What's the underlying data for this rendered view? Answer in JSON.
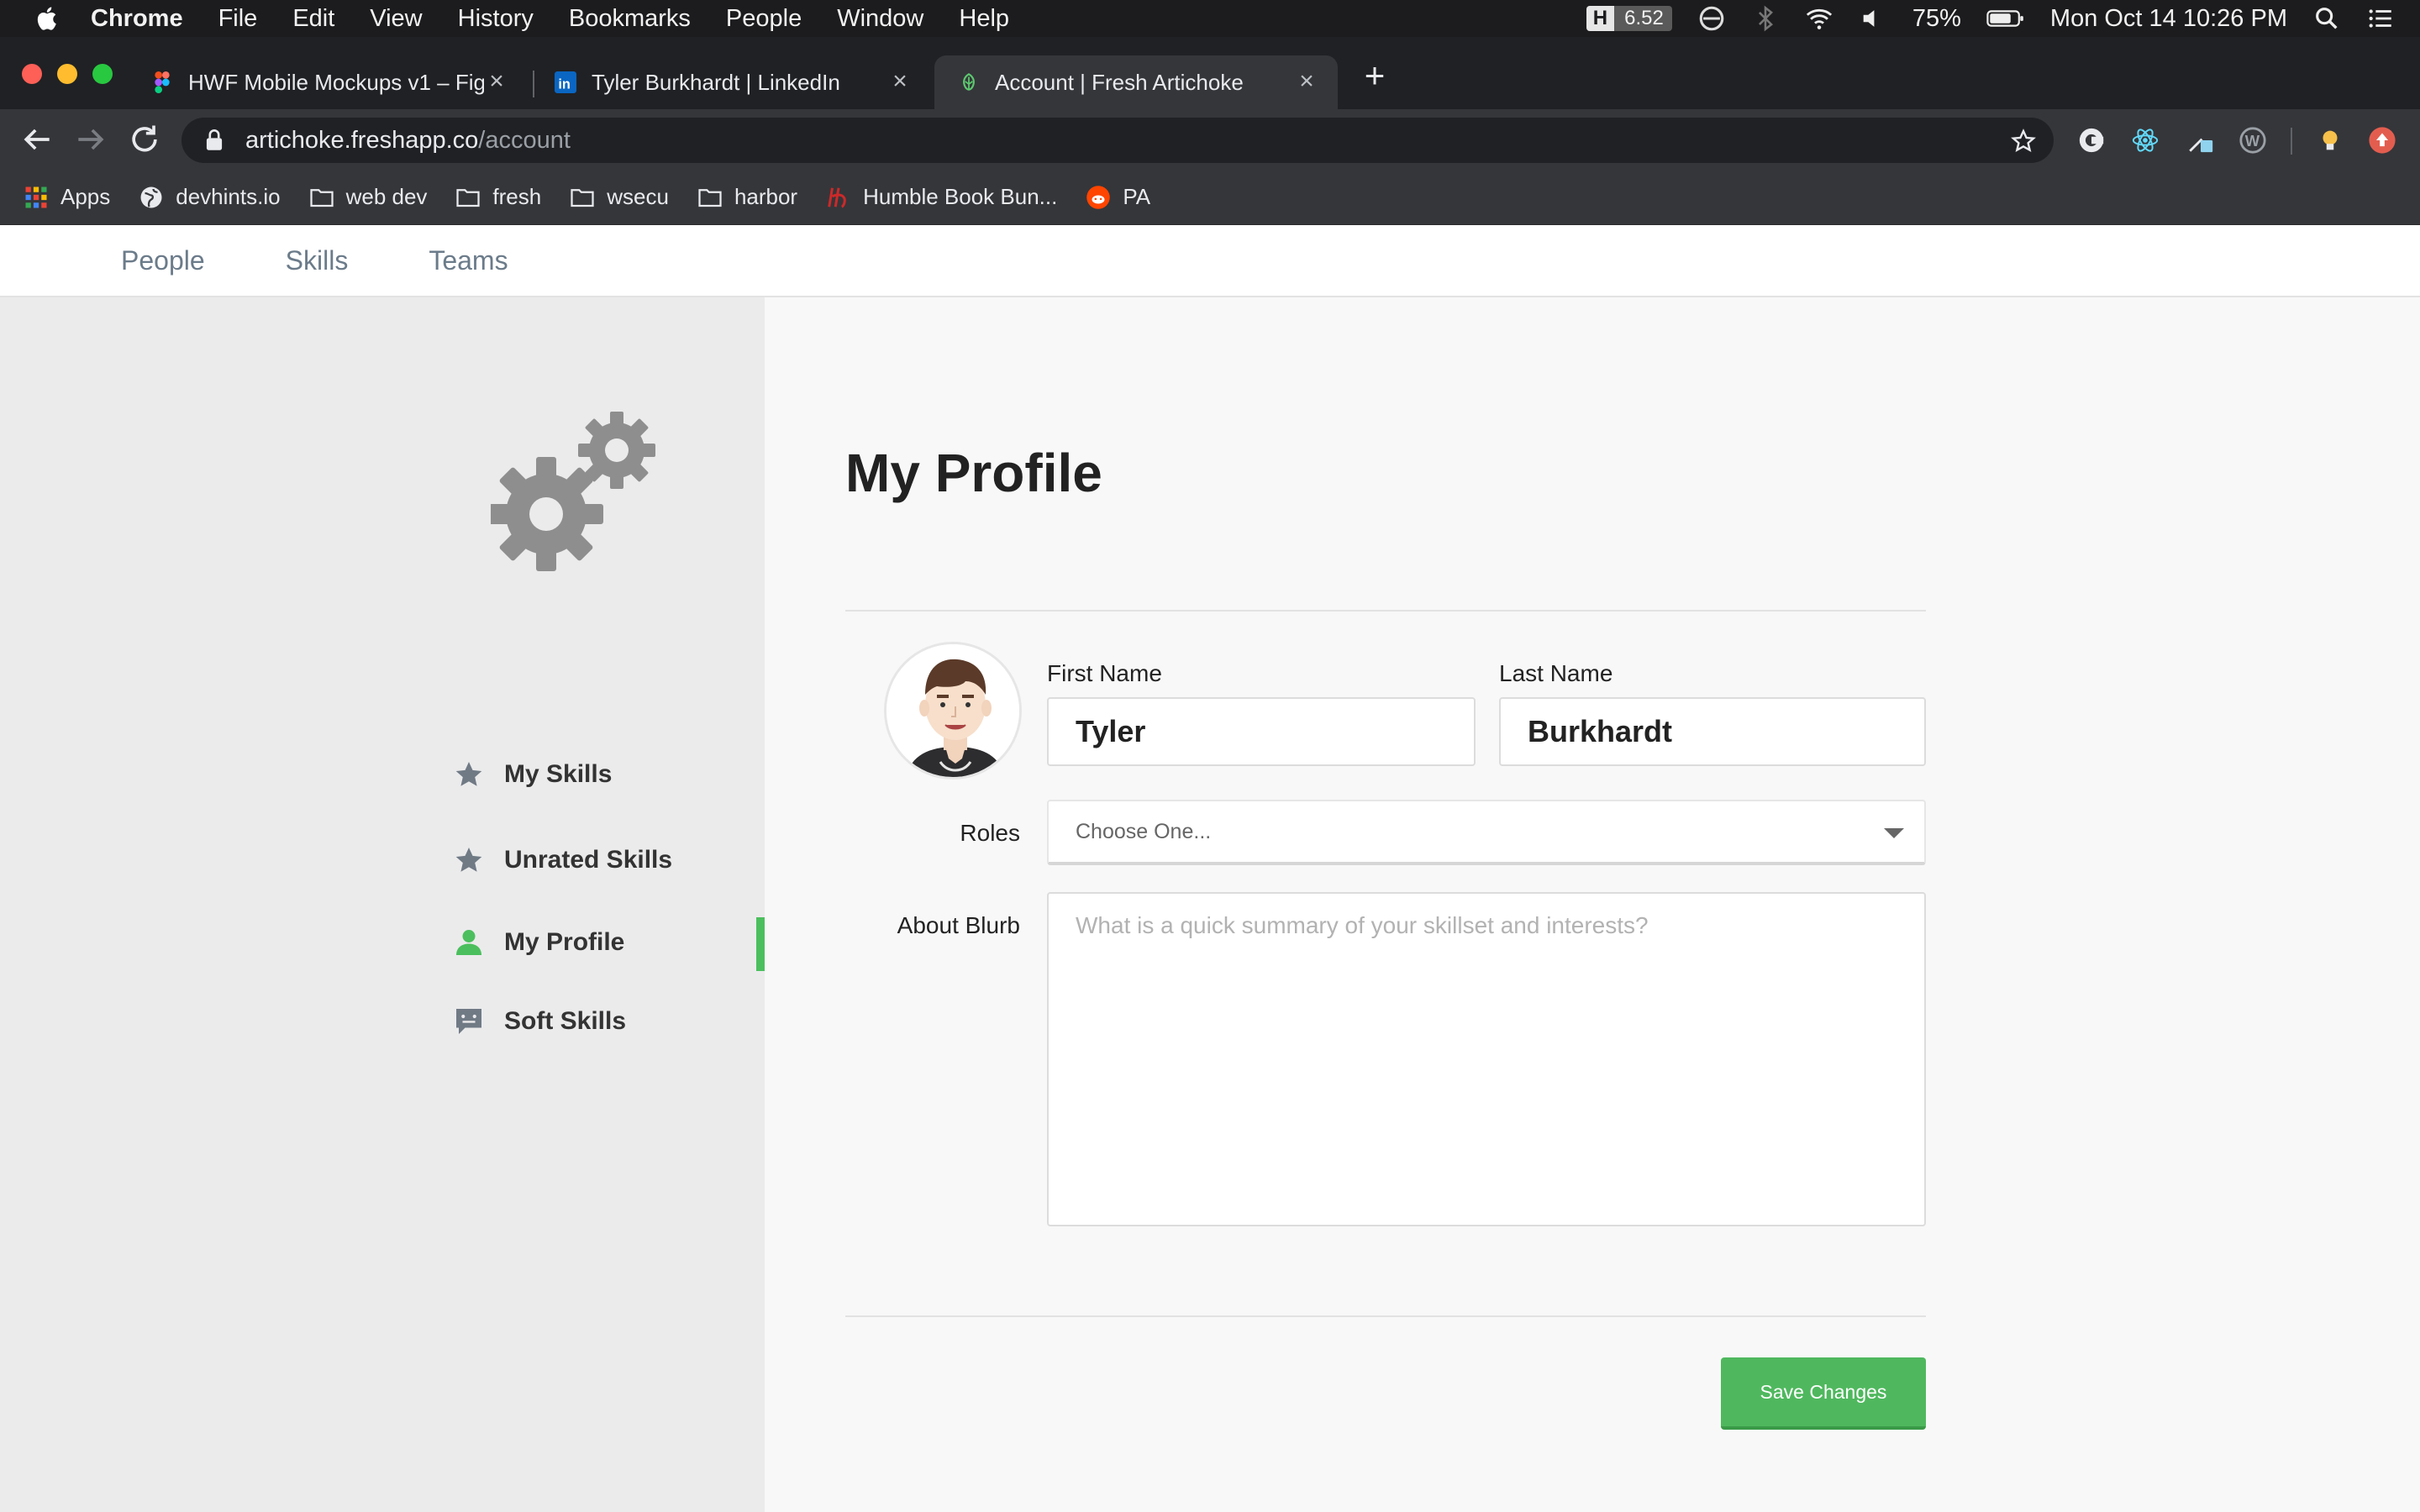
{
  "menubar": {
    "app_name": "Chrome",
    "items": [
      "File",
      "Edit",
      "View",
      "History",
      "Bookmarks",
      "People",
      "Window",
      "Help"
    ],
    "status": {
      "h_badge": "H",
      "h_value": "6.52",
      "battery": "75%",
      "datetime": "Mon Oct 14  10:26 PM"
    }
  },
  "browser": {
    "tabs": [
      {
        "title": "HWF Mobile Mockups v1 – Figma",
        "favicon": "figma-icon",
        "active": false
      },
      {
        "title": "Tyler Burkhardt | LinkedIn",
        "favicon": "linkedin-icon",
        "active": false
      },
      {
        "title": "Account | Fresh Artichoke",
        "favicon": "artichoke-icon",
        "active": true
      }
    ],
    "url_host": "artichoke.freshapp.co",
    "url_path": "/account",
    "bookmarks": [
      {
        "label": "Apps",
        "icon": "apps-grid-icon"
      },
      {
        "label": "devhints.io",
        "icon": "globe-icon"
      },
      {
        "label": "web dev",
        "icon": "folder-icon"
      },
      {
        "label": "fresh",
        "icon": "folder-icon"
      },
      {
        "label": "wsecu",
        "icon": "folder-icon"
      },
      {
        "label": "harbor",
        "icon": "folder-icon"
      },
      {
        "label": "Humble Book Bun...",
        "icon": "humble-icon"
      },
      {
        "label": "PA",
        "icon": "reddit-icon"
      }
    ]
  },
  "app_nav": {
    "links": [
      "People",
      "Skills",
      "Teams"
    ]
  },
  "sidebar": {
    "items": [
      {
        "label": "My Skills",
        "icon": "star-icon",
        "active": false
      },
      {
        "label": "Unrated Skills",
        "icon": "star-icon",
        "active": false
      },
      {
        "label": "My Profile",
        "icon": "user-icon",
        "active": true
      },
      {
        "label": "Soft Skills",
        "icon": "chat-icon",
        "active": false
      }
    ]
  },
  "profile": {
    "title": "My Profile",
    "first_name_label": "First Name",
    "first_name_value": "Tyler",
    "last_name_label": "Last Name",
    "last_name_value": "Burkhardt",
    "roles_label": "Roles",
    "roles_placeholder": "Choose One...",
    "about_label": "About Blurb",
    "about_placeholder": "What is a quick summary of your skillset and interests?",
    "save_label": "Save Changes"
  },
  "colors": {
    "accent_green": "#4fb85e",
    "sidebar_bg": "#ebebec",
    "nav_link": "#6b7b8a"
  }
}
